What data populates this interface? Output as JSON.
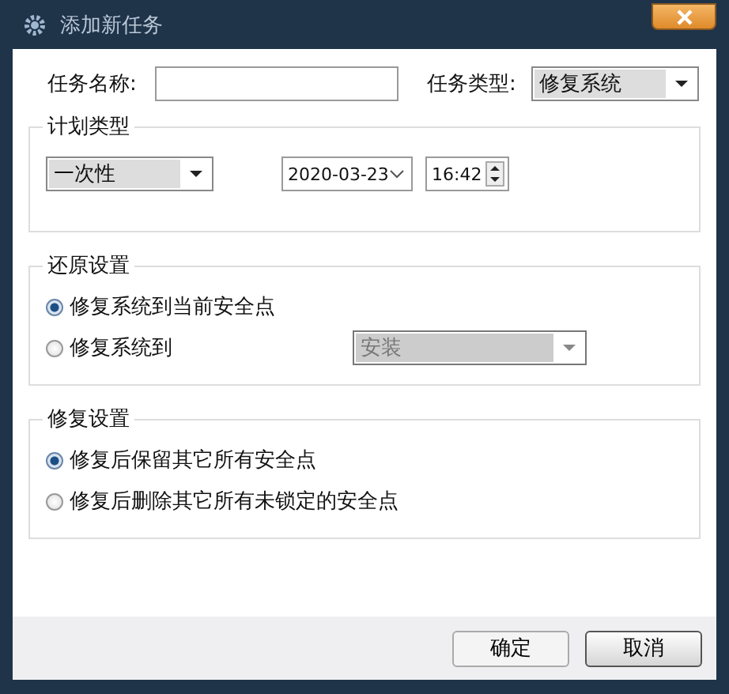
{
  "window": {
    "title": "添加新任务"
  },
  "task_name": {
    "label": "任务名称:"
  },
  "task_type": {
    "label": "任务类型:",
    "value": "修复系统"
  },
  "schedule": {
    "title": "计划类型",
    "frequency": "一次性",
    "date": "2020-03-23",
    "time": "16:42"
  },
  "restore": {
    "title": "还原设置",
    "options": [
      {
        "label": "修复系统到当前安全点",
        "selected": true
      },
      {
        "label": "修复系统到",
        "selected": false,
        "target": {
          "value": "安装",
          "disabled": true
        }
      }
    ]
  },
  "repair": {
    "title": "修复设置",
    "options": [
      {
        "label": "修复后保留其它所有安全点",
        "selected": true
      },
      {
        "label": "修复后删除其它所有未锁定的安全点",
        "selected": false
      }
    ]
  },
  "buttons": [
    {
      "label": "确定",
      "default": false
    },
    {
      "label": "取消",
      "default": true
    }
  ]
}
